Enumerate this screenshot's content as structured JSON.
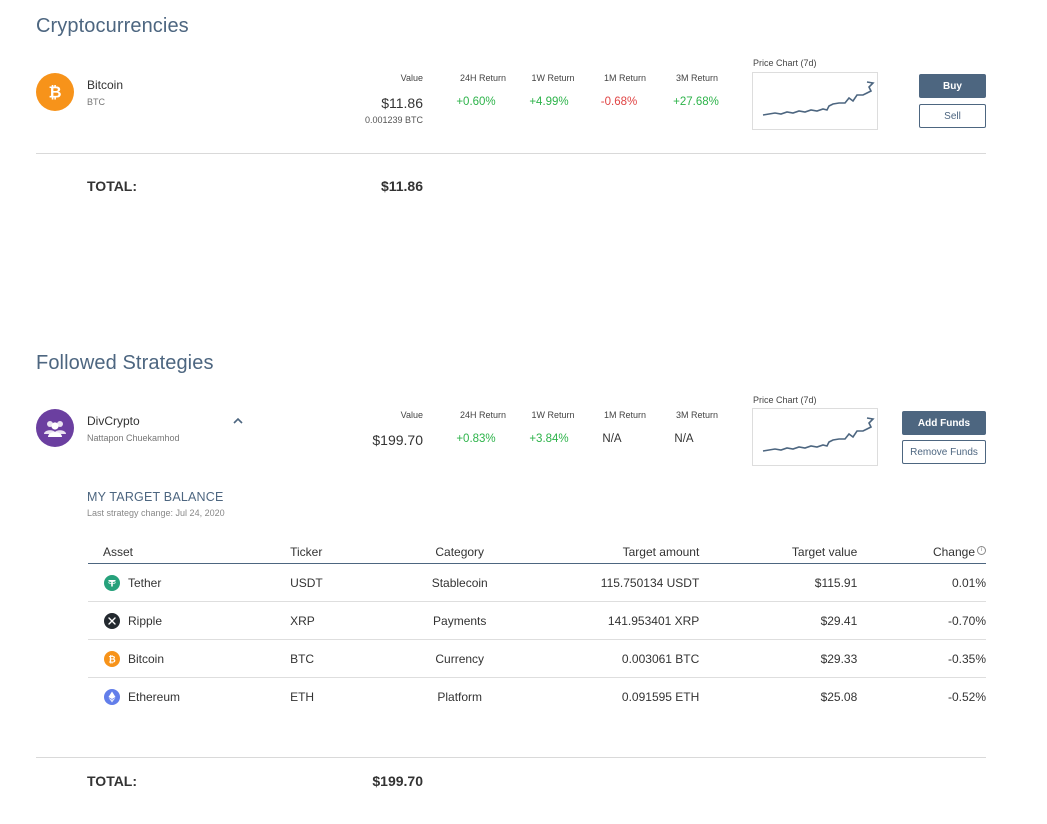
{
  "crypto": {
    "title": "Cryptocurrencies",
    "asset": {
      "name": "Bitcoin",
      "ticker": "BTC",
      "icon": "bitcoin-icon",
      "value_label": "Value",
      "value": "$11.86",
      "value_sub": "0.001239 BTC",
      "returns": [
        {
          "label": "24H Return",
          "value": "+0.60%",
          "trend": "positive"
        },
        {
          "label": "1W Return",
          "value": "+4.99%",
          "trend": "positive"
        },
        {
          "label": "1M Return",
          "value": "-0.68%",
          "trend": "negative"
        },
        {
          "label": "3M Return",
          "value": "+27.68%",
          "trend": "positive"
        }
      ],
      "chart_label": "Price Chart (7d)",
      "buy_label": "Buy",
      "sell_label": "Sell"
    },
    "total_label": "TOTAL:",
    "total_value": "$11.86"
  },
  "strategies": {
    "title": "Followed Strategies",
    "strategy": {
      "name": "DivCrypto",
      "author": "Nattapon Chuekamhod",
      "icon": "group-icon",
      "value_label": "Value",
      "value": "$199.70",
      "returns": [
        {
          "label": "24H Return",
          "value": "+0.83%",
          "trend": "positive"
        },
        {
          "label": "1W Return",
          "value": "+3.84%",
          "trend": "positive"
        },
        {
          "label": "1M Return",
          "value": "N/A",
          "trend": "none"
        },
        {
          "label": "3M Return",
          "value": "N/A",
          "trend": "none"
        }
      ],
      "chart_label": "Price Chart (7d)",
      "add_funds_label": "Add Funds",
      "remove_funds_label": "Remove Funds"
    },
    "target": {
      "title": "MY TARGET BALANCE",
      "subtitle": "Last strategy change: Jul 24, 2020",
      "columns": {
        "asset": "Asset",
        "ticker": "Ticker",
        "category": "Category",
        "target_amount": "Target amount",
        "target_value": "Target value",
        "change": "Change"
      },
      "rows": [
        {
          "asset": "Tether",
          "ticker": "USDT",
          "category": "Stablecoin",
          "target_amount": "115.750134 USDT",
          "target_value": "$115.91",
          "change": "0.01%",
          "trend": "positive",
          "icon": "tether-icon"
        },
        {
          "asset": "Ripple",
          "ticker": "XRP",
          "category": "Payments",
          "target_amount": "141.953401 XRP",
          "target_value": "$29.41",
          "change": "-0.70%",
          "trend": "negative",
          "icon": "ripple-icon"
        },
        {
          "asset": "Bitcoin",
          "ticker": "BTC",
          "category": "Currency",
          "target_amount": "0.003061 BTC",
          "target_value": "$29.33",
          "change": "-0.35%",
          "trend": "negative",
          "icon": "bitcoin-icon"
        },
        {
          "asset": "Ethereum",
          "ticker": "ETH",
          "category": "Platform",
          "target_amount": "0.091595 ETH",
          "target_value": "$25.08",
          "change": "-0.52%",
          "trend": "negative",
          "icon": "ethereum-icon"
        }
      ]
    },
    "total_label": "TOTAL:",
    "total_value": "$199.70"
  },
  "colors": {
    "accent": "#4d6680",
    "positive": "#2db34a",
    "negative": "#e04444",
    "bitcoin": "#f7931a",
    "strategy": "#6b3fa0",
    "tether": "#26a17b",
    "ripple": "#23292f",
    "ethereum": "#627eea",
    "sparkline": "#4d6680"
  }
}
